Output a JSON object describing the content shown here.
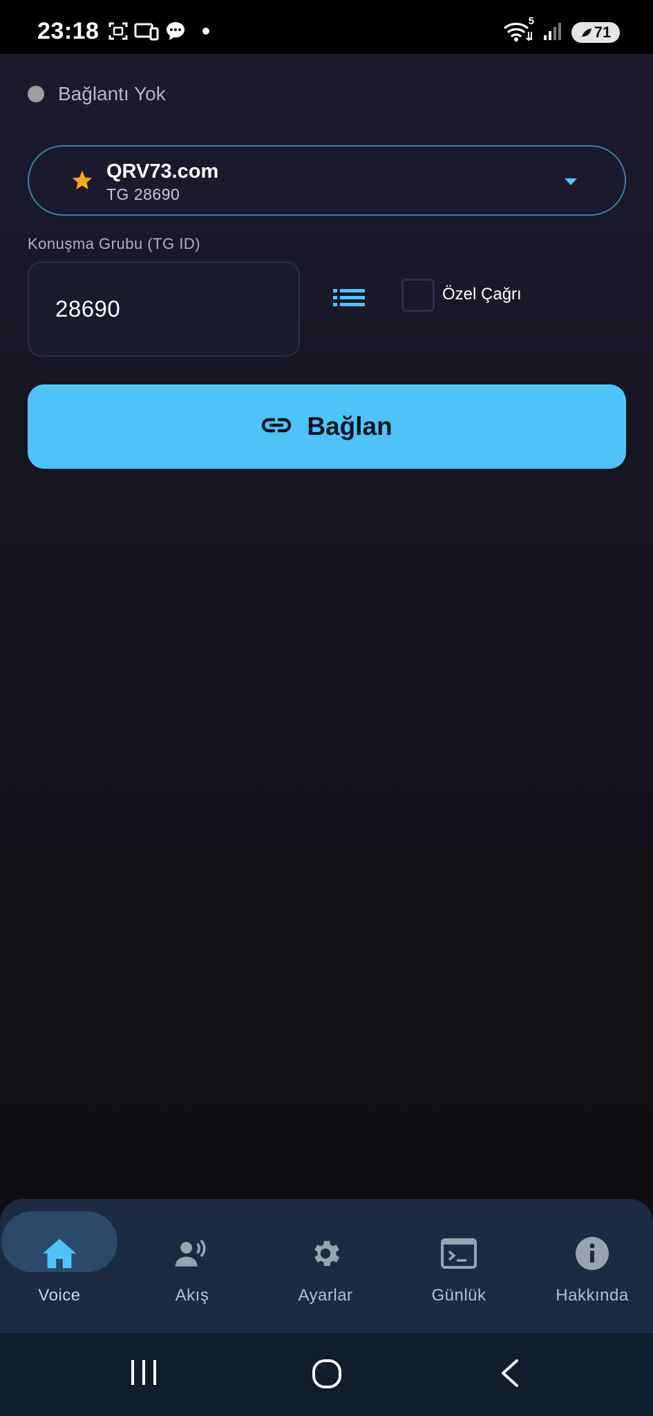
{
  "status_bar": {
    "time": "23:18",
    "battery": "71",
    "wifi_badge": "5",
    "icons": [
      "screenshot-icon",
      "cast-icon",
      "chat-icon",
      "dot-icon",
      "wifi-icon",
      "signal-icon",
      "battery-icon"
    ]
  },
  "connection": {
    "status_text": "Bağlantı Yok",
    "status_color": "#9e9e9e"
  },
  "server": {
    "name": "QRV73.com",
    "tg": "TG 28690",
    "star_color": "#f5a623"
  },
  "talkgroup": {
    "label": "Konuşma Grubu (TG ID)",
    "value": "28690"
  },
  "private_call": {
    "label": "Özel Çağrı",
    "checked": false
  },
  "connect_button": {
    "label": "Bağlan",
    "color": "#4fc3f7"
  },
  "bottom_nav": {
    "items": [
      {
        "label": "Voice",
        "icon": "home-icon",
        "active": true
      },
      {
        "label": "Akış",
        "icon": "speaker-person-icon",
        "active": false
      },
      {
        "label": "Ayarlar",
        "icon": "gear-icon",
        "active": false
      },
      {
        "label": "Günlük",
        "icon": "terminal-icon",
        "active": false
      },
      {
        "label": "Hakkında",
        "icon": "info-icon",
        "active": false
      }
    ]
  },
  "system_nav": {
    "icons": [
      "recents-icon",
      "home-circle-icon",
      "back-icon"
    ]
  },
  "colors": {
    "accent": "#4fc3f7",
    "nav_bg": "#1c2a44",
    "background": "#0f0f13"
  }
}
